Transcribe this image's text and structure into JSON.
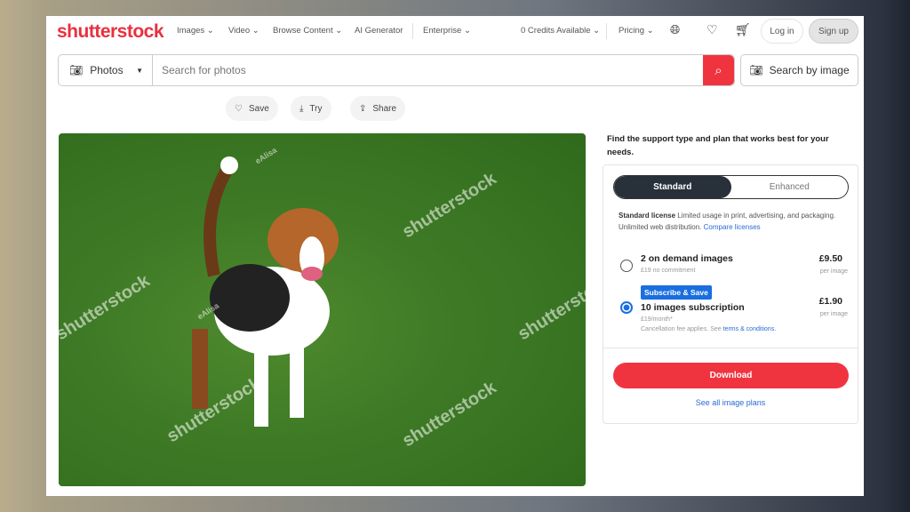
{
  "header": {
    "logo": "shutterstock",
    "nav": [
      "Images",
      "Video",
      "Browse Content",
      "AI Generator",
      "Enterprise"
    ],
    "credits": "0 Credits Available",
    "pricing": "Pricing",
    "login": "Log in",
    "signup": "Sign up"
  },
  "search": {
    "type": "Photos",
    "placeholder": "Search for photos",
    "by_image": "Search by image"
  },
  "actions": {
    "save": "Save",
    "try": "Try",
    "share": "Share"
  },
  "image": {
    "watermark": "shutterstock",
    "contributor": "eAlisa"
  },
  "panel": {
    "heading": "Find the support type and plan that works best for your needs.",
    "tabs": [
      "Standard",
      "Enhanced"
    ],
    "license_title": "Standard license",
    "license_desc": " Limited usage in print, advertising, and packaging. Unlimited web distribution. ",
    "compare": "Compare licenses",
    "plans": [
      {
        "title": "2 on demand images",
        "sub": "£19 no commitment",
        "price": "£9.50",
        "unit": "per image",
        "selected": false
      },
      {
        "badge": "Subscribe & Save",
        "title": "10 images subscription",
        "sub": "£19/month*",
        "note": "Cancellation fee applies. See ",
        "terms": "terms & conditions.",
        "price": "£1.90",
        "unit": "per image",
        "selected": true
      }
    ],
    "download": "Download",
    "see_all": "See all image plans"
  },
  "colors": {
    "brand": "#e8303e",
    "accent": "#2a6ad6"
  }
}
